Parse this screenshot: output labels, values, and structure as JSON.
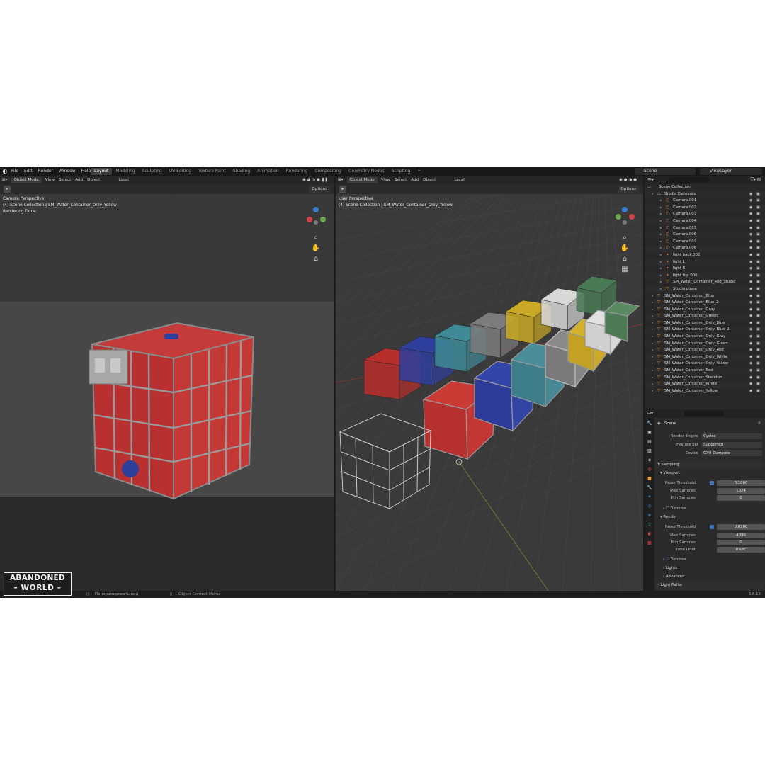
{
  "menu": [
    "File",
    "Edit",
    "Render",
    "Window",
    "Help"
  ],
  "workspaces": {
    "active": "Layout",
    "items": [
      "Layout",
      "Modeling",
      "Sculpting",
      "UV Editing",
      "Texture Paint",
      "Shading",
      "Animation",
      "Rendering",
      "Compositing",
      "Geometry Nodes",
      "Scripting",
      "+"
    ]
  },
  "scene": "Scene",
  "view_layer": "ViewLayer",
  "left_viewport": {
    "mode": "Object Mode",
    "menus": [
      "View",
      "Select",
      "Add",
      "Object"
    ],
    "transform": "Local",
    "options": "Options",
    "overlay": [
      "Camera Perspective",
      "(4) Scene Collection | SM_Water_Container_Only_Yellow",
      "Rendering Done"
    ]
  },
  "right_viewport": {
    "mode": "Object Mode",
    "menus": [
      "View",
      "Select",
      "Add",
      "Object"
    ],
    "transform": "Local",
    "options": "Options",
    "overlay": [
      "User Perspective",
      "(4) Scene Collection | SM_Water_Container_Only_Yellow"
    ],
    "containers": [
      {
        "color": "#b82e2b"
      },
      {
        "color": "#2f3f9e"
      },
      {
        "color": "#3f8a96"
      },
      {
        "color": "#7c7c7c"
      },
      {
        "color": "#c9a825"
      },
      {
        "color": "#d8d8d8"
      },
      {
        "color": "#4a7a55"
      }
    ]
  },
  "outliner": {
    "root": "Scene Collection",
    "rows": [
      {
        "name": "Studio Elements",
        "type": "collection",
        "level": 1
      },
      {
        "name": "Camera.001",
        "type": "camera",
        "level": 2
      },
      {
        "name": "Camera.002",
        "type": "camera",
        "level": 2
      },
      {
        "name": "Camera.003",
        "type": "camera",
        "level": 2
      },
      {
        "name": "Camera.004",
        "type": "camera",
        "level": 2
      },
      {
        "name": "Camera.005",
        "type": "camera",
        "level": 2
      },
      {
        "name": "Camera.006",
        "type": "camera",
        "level": 2
      },
      {
        "name": "Camera.007",
        "type": "camera",
        "level": 2
      },
      {
        "name": "Camera.008",
        "type": "camera",
        "level": 2
      },
      {
        "name": "light back.002",
        "type": "light",
        "level": 2
      },
      {
        "name": "light L",
        "type": "light",
        "level": 2
      },
      {
        "name": "light R",
        "type": "light",
        "level": 2
      },
      {
        "name": "light top.006",
        "type": "light",
        "level": 2
      },
      {
        "name": "SM_Water_Container_Red_Studio",
        "type": "mesh",
        "level": 2
      },
      {
        "name": "Studio plane",
        "type": "mesh",
        "level": 2
      },
      {
        "name": "SM_Water_Container_Blue",
        "type": "mesh",
        "level": 1
      },
      {
        "name": "SM_Water_Container_Blue_2",
        "type": "mesh",
        "level": 1
      },
      {
        "name": "SM_Water_Container_Gray",
        "type": "mesh",
        "level": 1
      },
      {
        "name": "SM_Water_Container_Green",
        "type": "mesh",
        "level": 1
      },
      {
        "name": "SM_Water_Container_Only_Blue",
        "type": "mesh",
        "level": 1
      },
      {
        "name": "SM_Water_Container_Only_Blue_2",
        "type": "mesh",
        "level": 1
      },
      {
        "name": "SM_Water_Container_Only_Gray",
        "type": "mesh",
        "level": 1
      },
      {
        "name": "SM_Water_Container_Only_Green",
        "type": "mesh",
        "level": 1
      },
      {
        "name": "SM_Water_Container_Only_Red",
        "type": "mesh",
        "level": 1
      },
      {
        "name": "SM_Water_Container_Only_White",
        "type": "mesh",
        "level": 1
      },
      {
        "name": "SM_Water_Container_Only_Yellow",
        "type": "mesh",
        "level": 1
      },
      {
        "name": "SM_Water_Container_Red",
        "type": "mesh",
        "level": 1
      },
      {
        "name": "SM_Water_Container_Skeleton",
        "type": "mesh",
        "level": 1
      },
      {
        "name": "SM_Water_Container_White",
        "type": "mesh",
        "level": 1
      },
      {
        "name": "SM_Water_Container_Yellow",
        "type": "mesh",
        "level": 1
      }
    ]
  },
  "properties": {
    "context": "Scene",
    "render_engine": {
      "label": "Render Engine",
      "value": "Cycles"
    },
    "feature_set": {
      "label": "Feature Set",
      "value": "Supported"
    },
    "device": {
      "label": "Device",
      "value": "GPU Compute"
    },
    "sampling": "Sampling",
    "viewport": {
      "title": "Viewport",
      "noise_label": "Noise Threshold",
      "noise": "0.1000",
      "max_label": "Max Samples",
      "max": "1024",
      "min_label": "Min Samples",
      "min": "0"
    },
    "denoise_viewport": "Denoise",
    "render": {
      "title": "Render",
      "noise_label": "Noise Threshold",
      "noise": "0.0100",
      "max_label": "Max Samples",
      "max": "4096",
      "min_label": "Min Samples",
      "min": "0",
      "time_label": "Time Limit",
      "time": "0 sec"
    },
    "denoise_render": "Denoise",
    "lights": "Lights",
    "advanced": "Advanced",
    "light_paths": "Light Paths"
  },
  "status": {
    "pan": "Панорамировать вид",
    "context": "Object Context Menu",
    "version": "3.6.12"
  },
  "logo": {
    "line1": "ABANDONED",
    "line2": "WORLD"
  }
}
